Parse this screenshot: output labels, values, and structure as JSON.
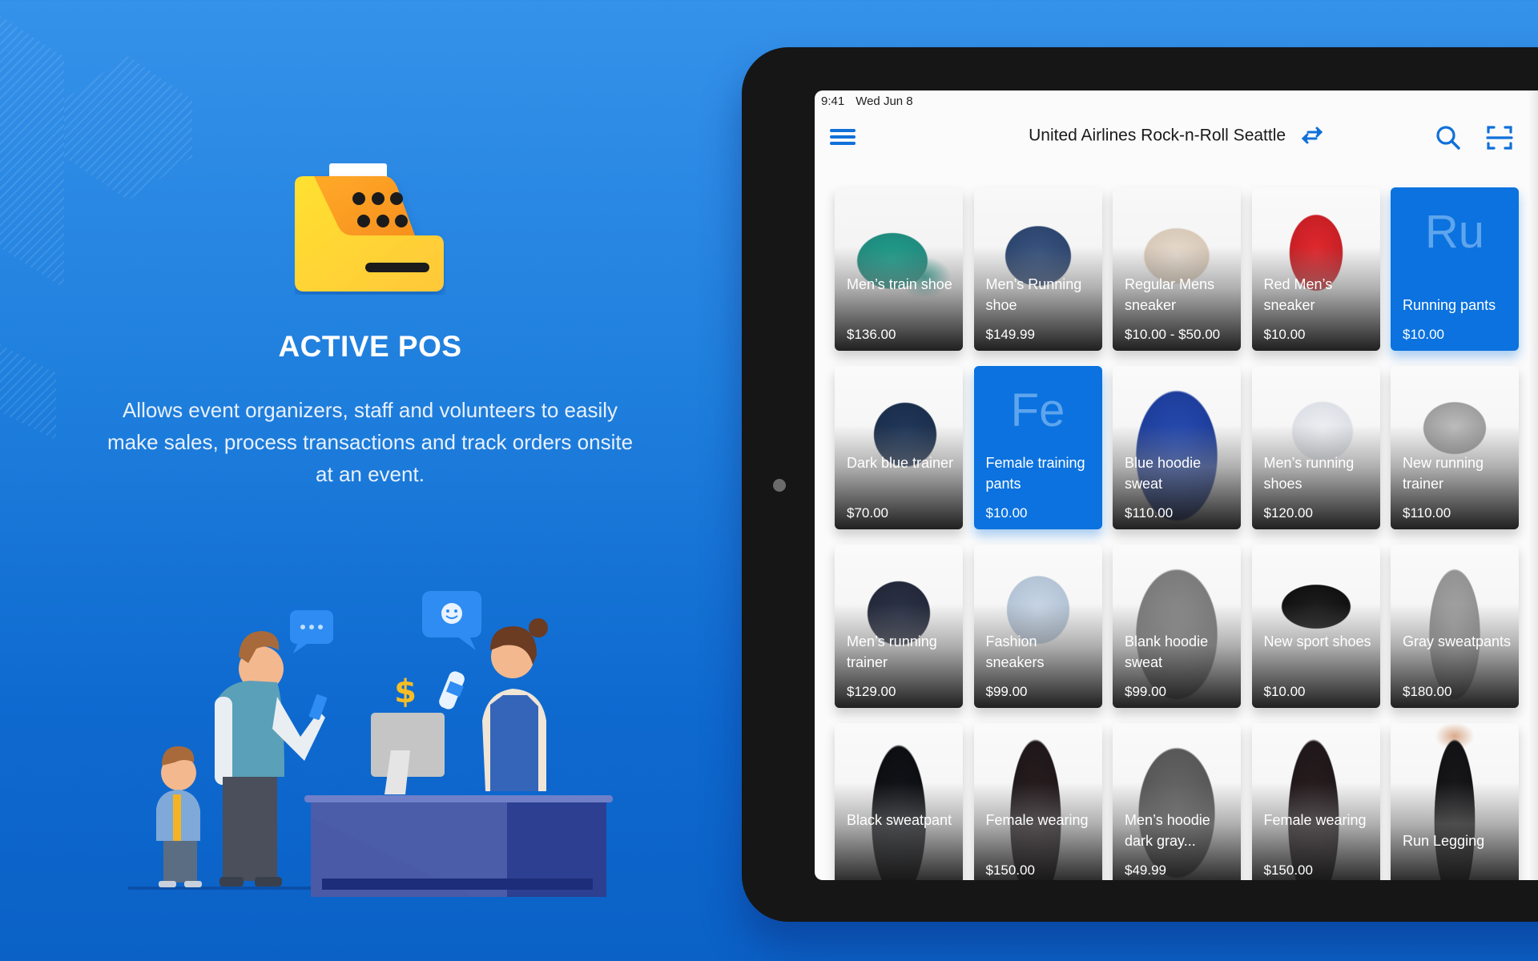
{
  "hero": {
    "title": "ACTIVE POS",
    "description": "Allows event organizers, staff and volunteers to easily make sales, process transactions and track orders onsite at an event.",
    "logo_icon": "cash-register-icon",
    "illustration": "checkout-counter-illustration"
  },
  "device": {
    "status_bar": {
      "time": "9:41",
      "date": "Wed Jun 8"
    },
    "header": {
      "menu_icon": "hamburger-menu-icon",
      "event_title": "United Airlines Rock-n-Roll Seattle",
      "switch_icon": "swap-arrows-icon",
      "search_icon": "search-icon",
      "scan_icon": "barcode-scan-icon"
    },
    "colors": {
      "accent": "#1170d8",
      "tile_blue": "#0b72df",
      "tile_initials": "#5ea5ee"
    },
    "products": [
      {
        "name": "Men’s train shoe",
        "price": "$136.00",
        "type": "image",
        "art": "teal-sneaker"
      },
      {
        "name": "Men’s Running shoe",
        "price": "$149.99",
        "type": "image",
        "art": "navy-sneaker"
      },
      {
        "name": "Regular Mens sneaker",
        "price": "$10.00 - $50.00",
        "type": "image",
        "art": "white-red-sneaker"
      },
      {
        "name": "Red Men’s sneaker",
        "price": "$10.00",
        "type": "image",
        "art": "red-hightop"
      },
      {
        "name": "Running pants",
        "price": "$10.00",
        "type": "initials",
        "initials": "Ru"
      },
      {
        "name": "Dark blue trainer",
        "price": "$70.00",
        "type": "image",
        "art": "darkblue-trainer"
      },
      {
        "name": "Female training pants",
        "price": "$10.00",
        "type": "initials",
        "initials": "Fe"
      },
      {
        "name": "Blue hoodie sweat",
        "price": "$110.00",
        "type": "image",
        "art": "blue-hoodie"
      },
      {
        "name": "Men’s running shoes",
        "price": "$120.00",
        "type": "image",
        "art": "white-pink-runner"
      },
      {
        "name": "New running trainer",
        "price": "$110.00",
        "type": "image",
        "art": "gray-trainer"
      },
      {
        "name": "Men’s running trainer",
        "price": "$129.00",
        "type": "image",
        "art": "navy-runner"
      },
      {
        "name": "Fashion sneakers",
        "price": "$99.00",
        "type": "image",
        "art": "lightblue-sneaker"
      },
      {
        "name": "Blank hoodie sweat",
        "price": "$99.00",
        "type": "image",
        "art": "gray-hoodie"
      },
      {
        "name": "New sport shoes",
        "price": "$10.00",
        "type": "image",
        "art": "black-sport-shoe"
      },
      {
        "name": "Gray sweatpants",
        "price": "$180.00",
        "type": "image",
        "art": "gray-sweatpants"
      },
      {
        "name": "Black sweatpant",
        "price": "",
        "type": "image",
        "art": "black-sweatpant"
      },
      {
        "name": "Female wearing",
        "price": "$150.00",
        "type": "image",
        "art": "female-pants"
      },
      {
        "name": "Men’s hoodie dark gray...",
        "price": "$49.99",
        "type": "image",
        "art": "darkgray-hoodie"
      },
      {
        "name": "Female wearing",
        "price": "$150.00",
        "type": "image",
        "art": "female-pants"
      },
      {
        "name": "Run Legging",
        "price": "",
        "type": "image",
        "art": "black-legging"
      }
    ]
  }
}
